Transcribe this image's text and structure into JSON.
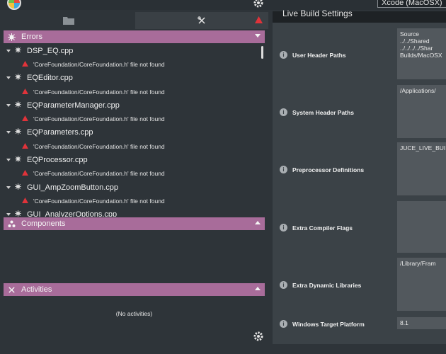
{
  "header": {
    "target_select": "Xcode (MacOSX)"
  },
  "errors": {
    "title": "Errors",
    "items": [
      {
        "file": "DSP_EQ.cpp",
        "message": "'CoreFoundation/CoreFoundation.h' file not found"
      },
      {
        "file": "EQEditor.cpp",
        "message": "'CoreFoundation/CoreFoundation.h' file not found"
      },
      {
        "file": "EQParameterManager.cpp",
        "message": "'CoreFoundation/CoreFoundation.h' file not found"
      },
      {
        "file": "EQParameters.cpp",
        "message": "'CoreFoundation/CoreFoundation.h' file not found"
      },
      {
        "file": "EQProcessor.cpp",
        "message": "'CoreFoundation/CoreFoundation.h' file not found"
      },
      {
        "file": "GUI_AmpZoomButton.cpp",
        "message": "'CoreFoundation/CoreFoundation.h' file not found"
      },
      {
        "file": "GUI_AnalyzerOptions.cpp",
        "message": ""
      }
    ]
  },
  "components": {
    "title": "Components"
  },
  "activities": {
    "title": "Activities",
    "empty": "(No activities)"
  },
  "settings": {
    "title": "Live Build Settings",
    "rows": [
      {
        "label": "User Header Paths",
        "value": "Source\n../../Shared\n../../../../Shar\nBuilds/MacOSX"
      },
      {
        "label": "System Header Paths",
        "value": "/Applications/"
      },
      {
        "label": "Preprocessor Definitions",
        "value": "JUCE_LIVE_BUI"
      },
      {
        "label": "Extra Compiler Flags",
        "value": ""
      },
      {
        "label": "Extra Dynamic Libraries",
        "value": "/Library/Fram"
      },
      {
        "label": "Windows Target Platform",
        "value": "8.1"
      }
    ]
  },
  "colors": {
    "accent": "#a86c9a",
    "error": "#e0333a",
    "background": "#2e3439"
  }
}
